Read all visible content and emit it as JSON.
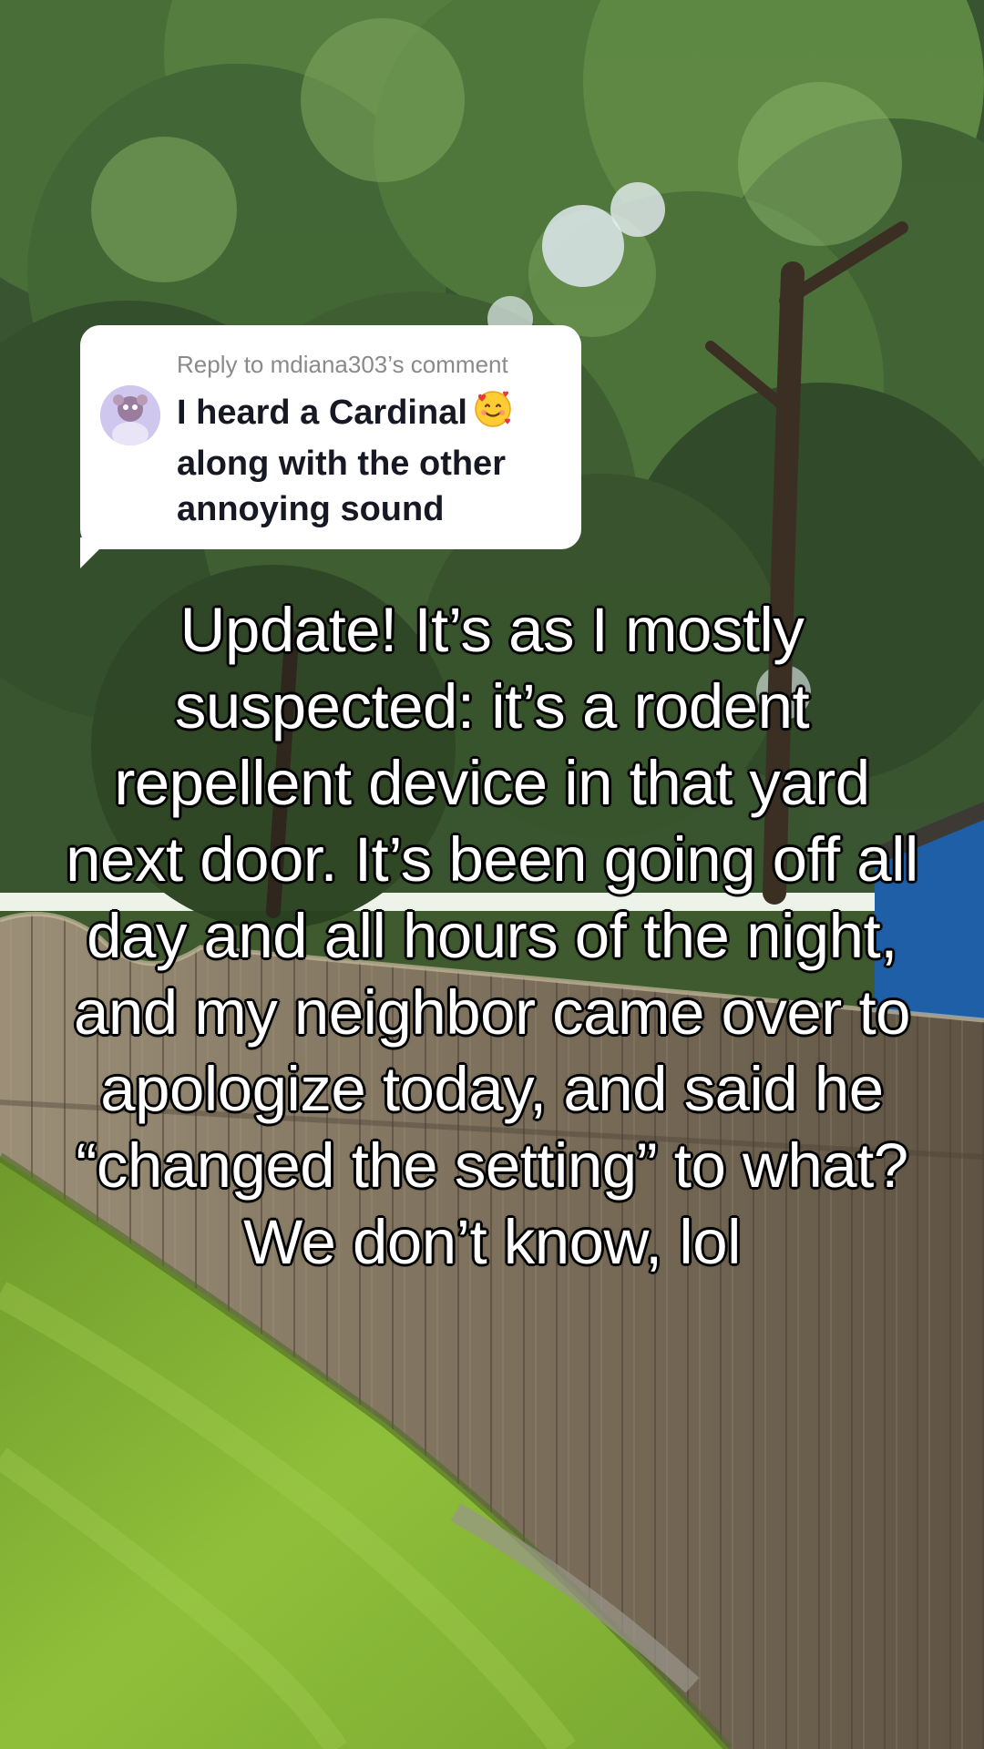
{
  "reply": {
    "header": "Reply to mdiana303’s comment",
    "text": "I heard a Cardinal",
    "text_cont": "along with the other annoying sound",
    "emoji_icon": "smiling-face-with-hearts-icon"
  },
  "caption": "Update! It’s as I mostly suspected: it’s a rodent repellent device in that yard next door. It’s been going off all day and all hours of the night, and my neighbor came over to apologize today, and said he “changed the setting” to what? We don’t know, lol",
  "colors": {
    "bubble_bg": "#ffffff",
    "header_text": "#8a8a8a",
    "reply_text": "#161823",
    "caption_fill": "#ffffff",
    "caption_stroke": "#000000"
  }
}
